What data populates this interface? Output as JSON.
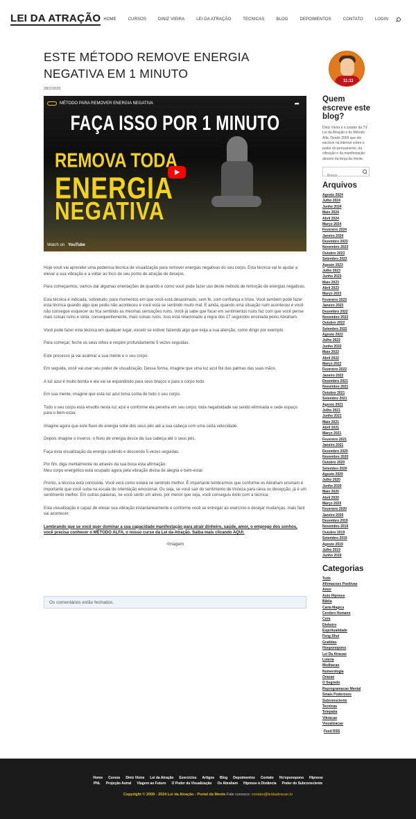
{
  "header": {
    "logo": "LEI DA ATRAÇÃO",
    "nav": [
      "Home",
      "CURSOS",
      "DINIZ VIEIRA",
      "LEI DA ATRAÇÃO",
      "TECNICAS",
      "BLOG",
      "DEPOIMENTOS",
      "CONTATO",
      "LOGIN"
    ]
  },
  "post": {
    "title": "ESTE MÉTODO REMOVE ENERGIA NEGATIVA EM 1 MINUTO",
    "date": "28/2/2020"
  },
  "video": {
    "title": "MÉTODO PARA REMOVER ENERGIA NEGATIVA",
    "headline": "FAÇA ISSO POR 1 MINUTO",
    "line1": "REMOVA TODA",
    "line2": "ENERGIA",
    "line3": "NEGATIVA",
    "watch_on": "Watch on",
    "youtube": "YouTube"
  },
  "content": {
    "paragraphs": [
      "Hoje você vai aprender uma poderosa técnica de visualização para remover energias negativas do seu corpo. Esta técnica vai te ajudar a elevar a sua vibração e a voltar ao foco do seu ponto de atração de desejos.",
      "Para começarmos, vamos dar algumas orientações de quando e como você pode fazer uso deste método de remoção de energias negativas.",
      "Esta técnica é indicada, sobretudo, para momentos em que você está desanimado, sem fé, com confiança e triste. Você também pode fazer esta técnica quando algo que pediu não aconteceu e você está se sentindo muito mal. E ainda, quando uma situação ruim aconteceu e você não consegue esquecer ou fica sentindo as mesmas sensações ruins. Você já sabe que focar em sentimentos ruins faz com que você pense mais coisas ruins e sinta, consequentemente, mais coisas ruins. Isso está relacionado à regra dos 17 segundos ensinada pelos Abraham.",
      "Você pode fazer esta técnica em qualquer lugar, exceto se estiver fazendo algo que exija a sua atenção, como dirigir por exemplo.",
      "Para começar, feche os seus olhos e respire profundamente 5 vezes seguidas.",
      "Este processo já vai acalmar a sua mente e o seu corpo.",
      "Em seguida, você vai usar seu poder de visualização. Dessa forma, imagine que uma luz azul flui das palmas das suas mãos.",
      "A luz azul é muito bonita e ela vai se expandindo para seus braços e para o corpo todo.",
      "Em sua mente, imagine que esta luz azul toma conta de todo o seu corpo.",
      "Todo o seu corpo está envolto nesta luz azul e conforme ela penetra em seu corpo, toda negatividade vai sendo eliminada e cede espaço para o bem-estar.",
      "Imagine agora que este fluxo de energia sobe dos seus pés até a sua cabeça com uma certa velocidade.",
      "Depois imagine o inverso: o fluxo de energia desce da sua cabeça até o seus pés.",
      "Faça esta visualização da energia subindo e descendo 5 vezes seguidas.",
      "Por fim, diga mentalmente ou através da sua boca esta afirmação:\nMeu corpo energético está ocupado agora pela vibração divina de alegria e bem-estar.",
      "Pronto, a técnica está concluída. Você verá como estará se sentindo melhor. É importante lembrarmos que conforme os Abraham ensinam é importante que você suba na escala de orientação emocional. Ou seja, se você sair do sentimento de tristeza para raiva ou decepção, já é um sentimento melhor. Em outras palavras, se você sentir um alívio, por menor que seja, você conseguiu êxito com a técnica.",
      "Esta visualização é capaz de elevar sua vibração instantaneamente e conforme você se entregar ao exercício e desejar mudanças, mais fácil vai acontecer."
    ],
    "cta": "Lembrando que se você quer dominar a sua capacidade manifestação para atrair dinheiro, saúde, amor, o emprego dos sonhos, você precisa conhecer o MÉTODO ALFA, o nosso curso da Lei da Atração. Saiba mais clicando AQUI.",
    "image_alt": "Imagem",
    "comments_closed": "Os comentários estão fechados."
  },
  "sidebar": {
    "author_heading": "Quem escreve este blog?",
    "author_text": "Diniz Vieira é o criador da TV Lei da Atração e do Método Alfa. Desde 2009 que ele escreve na internet sobre o poder do pensamento, da vibração e da manifestação através da força da mente.",
    "avatar_badge": "11:11",
    "search_placeholder": "Busca",
    "archives_heading": "Arquivos",
    "archives": [
      "Agosto 2024",
      "Julho 2024",
      "Junho 2024",
      "Maio 2024",
      "Abril 2024",
      "Março 2024",
      "Fevereiro 2024",
      "Janeiro 2024",
      "Dezembro 2023",
      "Novembro 2023",
      "Outubro 2023",
      "Setembro 2023",
      "Agosto 2023",
      "Julho 2023",
      "Junho 2023",
      "Maio 2023",
      "Abril 2023",
      "Março 2023",
      "Fevereiro 2023",
      "Janeiro 2023",
      "Dezembro 2022",
      "Novembro 2022",
      "Outubro 2022",
      "Setembro 2022",
      "Agosto 2022",
      "Julho 2022",
      "Junho 2022",
      "Maio 2022",
      "Abril 2022",
      "Março 2022",
      "Fevereiro 2022",
      "Janeiro 2022",
      "Dezembro 2021",
      "Novembro 2021",
      "Outubro 2021",
      "Setembro 2021",
      "Agosto 2021",
      "Julho 2021",
      "Junho 2021",
      "Maio 2021",
      "Abril 2021",
      "Março 2021",
      "Fevereiro 2021",
      "Janeiro 2021",
      "Dezembro 2020",
      "Novembro 2020",
      "Outubro 2020",
      "Setembro 2020",
      "Agosto 2020",
      "Julho 2020",
      "Junho 2020",
      "Maio 2020",
      "Abril 2020",
      "Março 2020",
      "Fevereiro 2020",
      "Janeiro 2020",
      "Dezembro 2019",
      "Novembro 2019",
      "Outubro 2019",
      "Setembro 2019",
      "Agosto 2019",
      "Julho 2019",
      "Junho 2019"
    ],
    "categories_heading": "Categorias",
    "categories": [
      "Tudo",
      "Afirmacoes Positivas",
      "Amor",
      "Auto Hipnose",
      "Bíblia",
      "Carta Magica",
      "Cerebro Humano",
      "Cura",
      "Dinheiro",
      "Espiritualidade",
      "Feng Shui",
      "Gratidao",
      "Hooponopono",
      "Lei Da Atracao",
      "Lotería",
      "Meditacao",
      "Numerologia",
      "Oracao",
      "O Segredo",
      "Reprogramacao Mental",
      "Sinais Poderosos",
      "Subconsciente",
      "Tecnicas",
      "Telepatia",
      "Vibracao",
      "Visualizacao"
    ],
    "feed": "Feed RSS"
  },
  "footer": {
    "links_row1": [
      "Home",
      "Cursos",
      "Diniz Vieira",
      "Lei da Atração",
      "Exercícios",
      "Artigos",
      "Blog",
      "Depoimentos",
      "Contato",
      "Ho'oponopono",
      "Hipnose"
    ],
    "links_row2": [
      "PNL",
      "Projeção Astral",
      "Viagem ao Futuro",
      "O Poder da Visualização",
      "Os Abraham",
      "Hipnose à Distância",
      "Poder do Subconsciente"
    ],
    "copyright": "Copyright © 2009 - 2024 Lei da Atração - Portal da Mente",
    "fale": "Fale conosco:",
    "email": "contato@leidaatracao.tv"
  }
}
